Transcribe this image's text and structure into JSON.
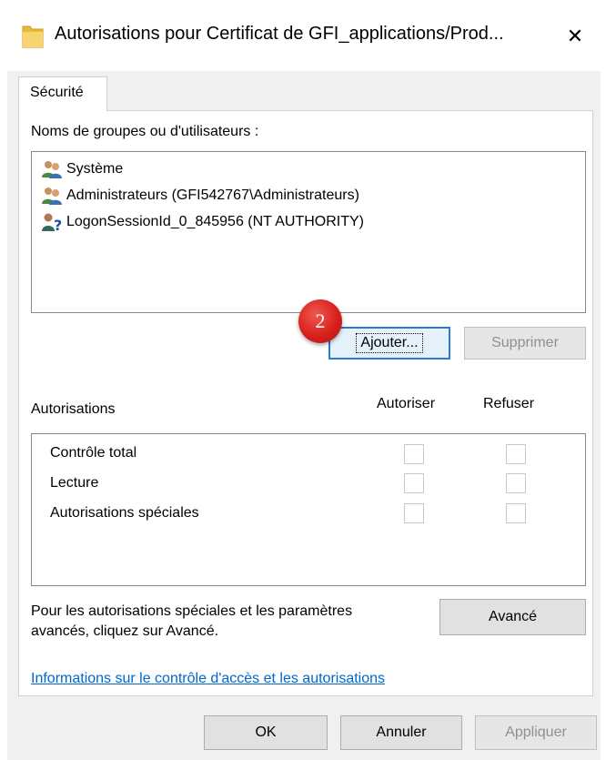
{
  "window": {
    "title": "Autorisations pour Certificat de GFI_applications/Prod...",
    "icon": "folder-icon",
    "close_glyph": "✕"
  },
  "tabs": [
    {
      "label": "Sécurité",
      "active": true
    }
  ],
  "users_section": {
    "label": "Noms de groupes ou d'utilisateurs :",
    "items": [
      {
        "label": "Système",
        "icon": "group-icon"
      },
      {
        "label": "Administrateurs (GFI542767\\Administrateurs)",
        "icon": "group-icon"
      },
      {
        "label": "LogonSessionId_0_845956 (NT AUTHORITY)",
        "icon": "unknown-user-icon"
      }
    ],
    "add_button": "Ajouter...",
    "remove_button": "Supprimer",
    "step_badge": "2"
  },
  "permissions_section": {
    "label": "Autorisations",
    "allow_header": "Autoriser",
    "deny_header": "Refuser",
    "rows": [
      {
        "label": "Contrôle total",
        "allow": false,
        "deny": false
      },
      {
        "label": "Lecture",
        "allow": false,
        "deny": false
      },
      {
        "label": "Autorisations spéciales",
        "allow": false,
        "deny": false
      }
    ]
  },
  "advanced": {
    "text_line1": "Pour les autorisations spéciales et les paramètres",
    "text_line2": "avancés, cliquez sur Avancé.",
    "button": "Avancé"
  },
  "help_link": "Informations sur le contrôle d'accès et les autorisations",
  "footer": {
    "ok": "OK",
    "cancel": "Annuler",
    "apply": "Appliquer"
  },
  "colors": {
    "accent": "#2a7ad6",
    "badge": "#d8201c",
    "link": "#0066cc"
  }
}
